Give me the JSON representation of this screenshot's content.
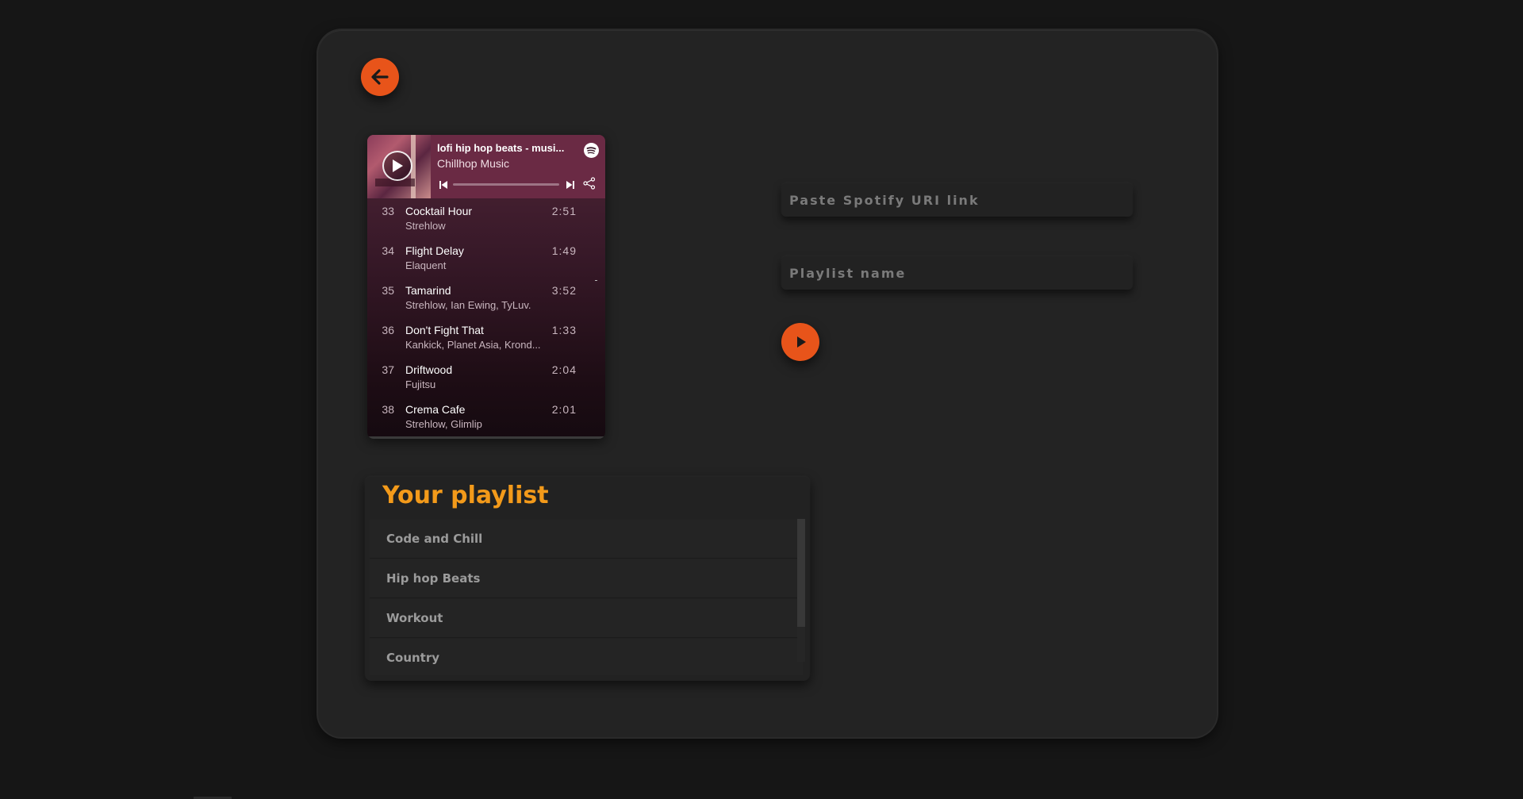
{
  "embed": {
    "title": "lofi hip hop beats - musi...",
    "artist": "Chillhop Music",
    "tracks": [
      {
        "num": "33",
        "name": "Cocktail Hour",
        "artist": "Strehlow",
        "duration": "2:51"
      },
      {
        "num": "34",
        "name": "Flight Delay",
        "artist": "Elaquent",
        "duration": "1:49"
      },
      {
        "num": "35",
        "name": "Tamarind",
        "artist": "Strehlow, Ian Ewing, TyLuv.",
        "duration": "3:52"
      },
      {
        "num": "36",
        "name": "Don't Fight That",
        "artist": "Kankick, Planet Asia, Krond...",
        "duration": "1:33"
      },
      {
        "num": "37",
        "name": "Driftwood",
        "artist": "Fujitsu",
        "duration": "2:04"
      },
      {
        "num": "38",
        "name": "Crema Cafe",
        "artist": "Strehlow, Glimlip",
        "duration": "2:01"
      }
    ]
  },
  "form": {
    "uri_placeholder": "Paste Spotify URI link",
    "name_placeholder": "Playlist name"
  },
  "playlists": {
    "title": "Your playlist",
    "items": [
      "Code and Chill",
      "Hip hop Beats",
      "Workout",
      "Country"
    ]
  },
  "colors": {
    "accent": "#e8541a",
    "title": "#f39a1a",
    "panel": "#232323",
    "background": "#161616"
  },
  "icons": {
    "back": "arrow-left-icon",
    "submit": "play-icon",
    "embed_play": "play-icon",
    "spotify": "spotify-logo-icon",
    "prev": "skip-previous-icon",
    "next": "skip-next-icon",
    "share": "share-icon"
  }
}
